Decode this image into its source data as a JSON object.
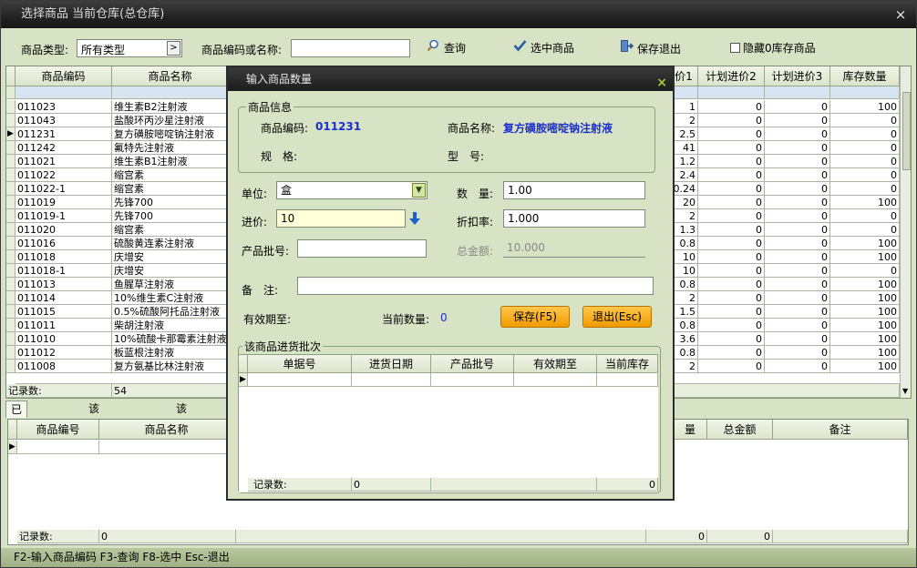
{
  "window": {
    "title": "选择商品 当前仓库(总仓库)",
    "close": "×"
  },
  "toolbar": {
    "type_label": "商品类型:",
    "type_value": "所有类型",
    "code_label": "商品编码或名称:",
    "code_value": "",
    "search_label": "查询",
    "select_label": "选中商品",
    "save_exit_label": "保存退出",
    "hide_zero_label": "隐藏0库存商品"
  },
  "product_grid": {
    "columns": [
      "商品编码",
      "商品名称",
      "价1",
      "计划进价2",
      "计划进价3",
      "库存数量"
    ],
    "rows": [
      {
        "code": "011023",
        "name": "维生素B2注射液",
        "p1": "1",
        "p2": "0",
        "p3": "0",
        "stock": "100"
      },
      {
        "code": "011043",
        "name": "盐酸环丙沙星注射液",
        "p1": "2",
        "p2": "0",
        "p3": "0",
        "stock": "0"
      },
      {
        "code": "011231",
        "name": "复方磺胺嘧啶钠注射液",
        "p1": "2.5",
        "p2": "0",
        "p3": "0",
        "stock": "0"
      },
      {
        "code": "011242",
        "name": "氟特先注射液",
        "p1": "41",
        "p2": "0",
        "p3": "0",
        "stock": "0"
      },
      {
        "code": "011021",
        "name": "维生素B1注射液",
        "p1": "1.2",
        "p2": "0",
        "p3": "0",
        "stock": "0"
      },
      {
        "code": "011022",
        "name": "缩宫素",
        "p1": "2.4",
        "p2": "0",
        "p3": "0",
        "stock": "0"
      },
      {
        "code": "011022-1",
        "name": "缩宫素",
        "p1": "0.24",
        "p2": "0",
        "p3": "0",
        "stock": "0"
      },
      {
        "code": "011019",
        "name": "先锋700",
        "p1": "20",
        "p2": "0",
        "p3": "0",
        "stock": "100"
      },
      {
        "code": "011019-1",
        "name": "先锋700",
        "p1": "2",
        "p2": "0",
        "p3": "0",
        "stock": "0"
      },
      {
        "code": "011020",
        "name": "缩宫素",
        "p1": "1.3",
        "p2": "0",
        "p3": "0",
        "stock": "0"
      },
      {
        "code": "011016",
        "name": "硫酸黄连素注射液",
        "p1": "0.8",
        "p2": "0",
        "p3": "0",
        "stock": "100"
      },
      {
        "code": "011018",
        "name": "庆增安",
        "p1": "10",
        "p2": "0",
        "p3": "0",
        "stock": "100"
      },
      {
        "code": "011018-1",
        "name": "庆增安",
        "p1": "10",
        "p2": "0",
        "p3": "0",
        "stock": "0"
      },
      {
        "code": "011013",
        "name": "鱼腥草注射液",
        "p1": "0.8",
        "p2": "0",
        "p3": "0",
        "stock": "100"
      },
      {
        "code": "011014",
        "name": "10%维生素C注射液",
        "p1": "2",
        "p2": "0",
        "p3": "0",
        "stock": "100"
      },
      {
        "code": "011015",
        "name": "0.5%硫酸阿托品注射液",
        "p1": "1.5",
        "p2": "0",
        "p3": "0",
        "stock": "100"
      },
      {
        "code": "011011",
        "name": "柴胡注射液",
        "p1": "0.8",
        "p2": "0",
        "p3": "0",
        "stock": "100"
      },
      {
        "code": "011010",
        "name": "10%硫酸卡那霉素注射液",
        "p1": "3.6",
        "p2": "0",
        "p3": "0",
        "stock": "100"
      },
      {
        "code": "011012",
        "name": "板蓝根注射液",
        "p1": "0.8",
        "p2": "0",
        "p3": "0",
        "stock": "100"
      },
      {
        "code": "011008",
        "name": "复方氨基比林注射液",
        "p1": "2",
        "p2": "0",
        "p3": "0",
        "stock": "100"
      }
    ],
    "footer_label": "记录数:",
    "footer_count": "54"
  },
  "tabs": [
    "已选择的商品",
    "该商品退货记录",
    "该供货商退"
  ],
  "selected_grid": {
    "columns": [
      "商品编号",
      "商品名称",
      "量",
      "总金额",
      "备注"
    ],
    "footer_label": "记录数:",
    "footer_count": "0",
    "footer_sum1": "0",
    "footer_sum2": "0"
  },
  "statusbar": {
    "text": "F2-输入商品编码 F3-查询 F8-选中 Esc-退出"
  },
  "modal": {
    "title": "输入商品数量",
    "close": "×",
    "info_group": "商品信息",
    "code_label": "商品编码:",
    "code_value": "011231",
    "name_label": "商品名称:",
    "name_value": "复方磺胺嘧啶钠注射液",
    "spec_label": "规　格:",
    "model_label": "型　号:",
    "unit_label": "单位:",
    "unit_value": "盒",
    "qty_label": "数　量:",
    "qty_value": "1.00",
    "price_label": "进价:",
    "price_value": "10",
    "discount_label": "折扣率:",
    "discount_value": "1.000",
    "batch_label": "产品批号:",
    "batch_value": "",
    "total_label": "总金额:",
    "total_value": "10.000",
    "remark_label": "备　注:",
    "remark_value": "",
    "expiry_label": "有效期至:",
    "current_qty_label": "当前数量:",
    "current_qty_value": "0",
    "save_button": "保存(F5)",
    "exit_button": "退出(Esc)",
    "batch_group": "该商品进货批次",
    "batch_columns": [
      "单据号",
      "进货日期",
      "产品批号",
      "有效期至",
      "当前库存"
    ],
    "batch_footer_label": "记录数:",
    "batch_footer_count": "0",
    "batch_footer_stock": "0"
  }
}
